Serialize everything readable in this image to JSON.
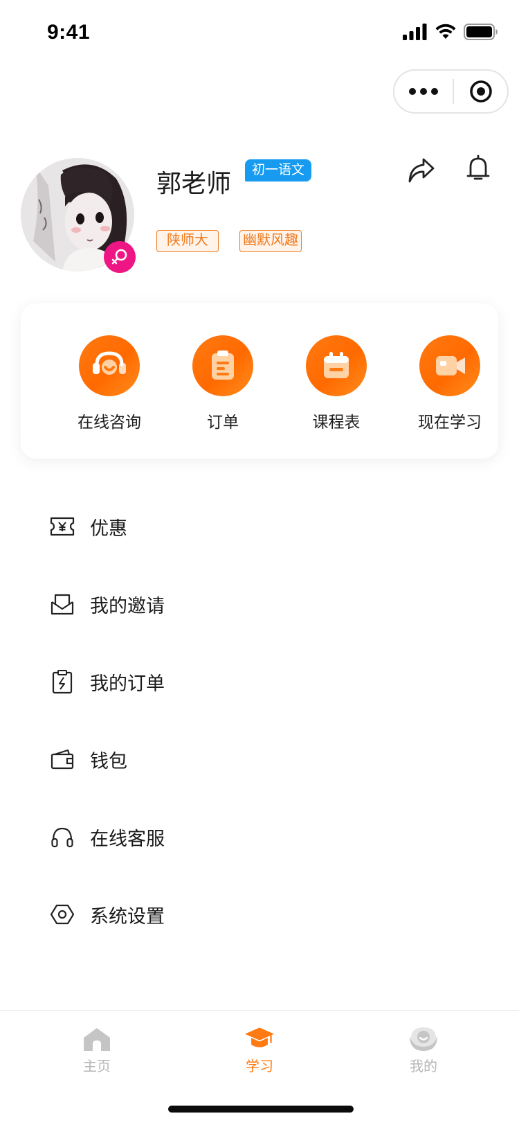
{
  "status_bar": {
    "time": "9:41"
  },
  "profile": {
    "name": "郭老师",
    "subject_badge": "初一语文",
    "tags": [
      "陕师大",
      "幽默风趣"
    ]
  },
  "quick_actions": [
    {
      "label": "在线咨询",
      "icon": "headset-smile-icon"
    },
    {
      "label": "订单",
      "icon": "clipboard-icon"
    },
    {
      "label": "课程表",
      "icon": "calendar-icon"
    },
    {
      "label": "现在学习",
      "icon": "video-camera-icon"
    }
  ],
  "menu": [
    {
      "label": "优惠",
      "icon": "coupon-yen-icon"
    },
    {
      "label": "我的邀请",
      "icon": "envelope-icon"
    },
    {
      "label": "我的订单",
      "icon": "order-clipboard-icon"
    },
    {
      "label": "钱包",
      "icon": "wallet-icon"
    },
    {
      "label": "在线客服",
      "icon": "headphones-icon"
    },
    {
      "label": "系统设置",
      "icon": "settings-hexagon-icon"
    }
  ],
  "tabbar": {
    "active": 1,
    "items": [
      {
        "label": "主页",
        "icon": "home-icon"
      },
      {
        "label": "学习",
        "icon": "graduation-cap-icon"
      },
      {
        "label": "我的",
        "icon": "profile-face-icon"
      }
    ]
  },
  "colors": {
    "accent": "#ff7a12",
    "tag_text": "#f07a1d",
    "subject_badge": "#169bf0",
    "gender_badge": "#ee1584",
    "tab_inactive": "#b6b6b6"
  }
}
